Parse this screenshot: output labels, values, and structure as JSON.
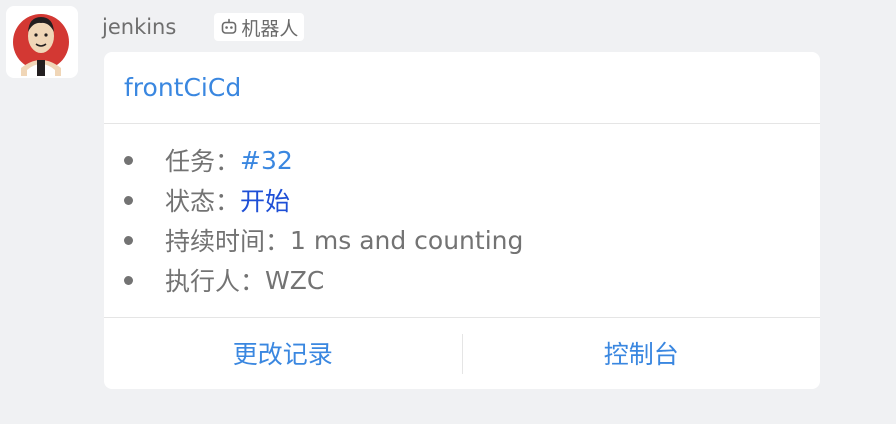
{
  "sender": {
    "name": "jenkins",
    "badge_label": "机器人"
  },
  "card": {
    "title": "frontCiCd",
    "fields": [
      {
        "key": "任务：",
        "value": "#32"
      },
      {
        "key": "状态：",
        "value": "开始"
      },
      {
        "key": "持续时间：",
        "value": "1 ms and counting"
      },
      {
        "key": "执行人：",
        "value": "WZC"
      }
    ],
    "actions": {
      "changes_label": "更改记录",
      "console_label": "控制台"
    }
  },
  "colors": {
    "link": "#3a87e0",
    "status": "#1e4fd6",
    "text": "#737373",
    "background": "#f0f1f3"
  },
  "icons": {
    "avatar": "jenkins-butler-icon",
    "badge": "robot-icon"
  }
}
